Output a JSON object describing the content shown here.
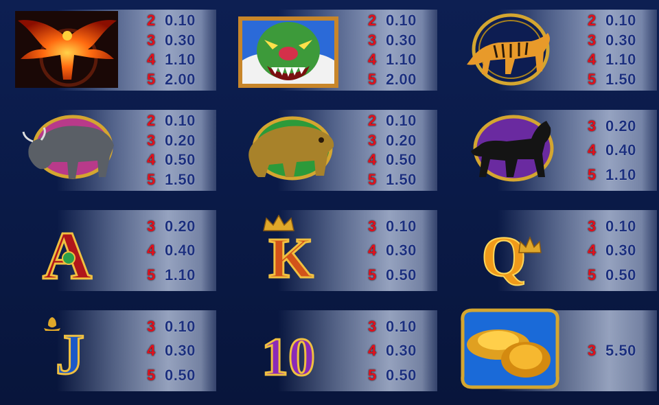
{
  "colors": {
    "count": "#e3101c",
    "value": "#1b2f7e",
    "background": "#0d1f52"
  },
  "paytable": [
    {
      "symbol": "phoenix",
      "icon": "phoenix-icon",
      "pays": [
        {
          "count": "2",
          "value": "0.10"
        },
        {
          "count": "3",
          "value": "0.30"
        },
        {
          "count": "4",
          "value": "1.10"
        },
        {
          "count": "5",
          "value": "2.00"
        }
      ]
    },
    {
      "symbol": "dragon",
      "icon": "dragon-icon",
      "pays": [
        {
          "count": "2",
          "value": "0.10"
        },
        {
          "count": "3",
          "value": "0.30"
        },
        {
          "count": "4",
          "value": "1.10"
        },
        {
          "count": "5",
          "value": "2.00"
        }
      ]
    },
    {
      "symbol": "tiger",
      "icon": "tiger-icon",
      "pays": [
        {
          "count": "2",
          "value": "0.10"
        },
        {
          "count": "3",
          "value": "0.30"
        },
        {
          "count": "4",
          "value": "1.10"
        },
        {
          "count": "5",
          "value": "1.50"
        }
      ]
    },
    {
      "symbol": "bull",
      "icon": "bull-icon",
      "pays": [
        {
          "count": "2",
          "value": "0.10"
        },
        {
          "count": "3",
          "value": "0.20"
        },
        {
          "count": "4",
          "value": "0.50"
        },
        {
          "count": "5",
          "value": "1.50"
        }
      ]
    },
    {
      "symbol": "bear",
      "icon": "bear-icon",
      "pays": [
        {
          "count": "2",
          "value": "0.10"
        },
        {
          "count": "3",
          "value": "0.20"
        },
        {
          "count": "4",
          "value": "0.50"
        },
        {
          "count": "5",
          "value": "1.50"
        }
      ]
    },
    {
      "symbol": "horse",
      "icon": "horse-icon",
      "pays": [
        {
          "count": "3",
          "value": "0.20"
        },
        {
          "count": "4",
          "value": "0.40"
        },
        {
          "count": "5",
          "value": "1.10"
        }
      ]
    },
    {
      "symbol": "A",
      "icon": "ace-icon",
      "glyph": "A",
      "pays": [
        {
          "count": "3",
          "value": "0.20"
        },
        {
          "count": "4",
          "value": "0.40"
        },
        {
          "count": "5",
          "value": "1.10"
        }
      ]
    },
    {
      "symbol": "K",
      "icon": "king-icon",
      "glyph": "K",
      "pays": [
        {
          "count": "3",
          "value": "0.10"
        },
        {
          "count": "4",
          "value": "0.30"
        },
        {
          "count": "5",
          "value": "0.50"
        }
      ]
    },
    {
      "symbol": "Q",
      "icon": "queen-icon",
      "glyph": "Q",
      "pays": [
        {
          "count": "3",
          "value": "0.10"
        },
        {
          "count": "4",
          "value": "0.30"
        },
        {
          "count": "5",
          "value": "0.50"
        }
      ]
    },
    {
      "symbol": "J",
      "icon": "jack-icon",
      "glyph": "J",
      "pays": [
        {
          "count": "3",
          "value": "0.10"
        },
        {
          "count": "4",
          "value": "0.30"
        },
        {
          "count": "5",
          "value": "0.50"
        }
      ]
    },
    {
      "symbol": "10",
      "icon": "ten-icon",
      "glyph": "10",
      "pays": [
        {
          "count": "3",
          "value": "0.10"
        },
        {
          "count": "4",
          "value": "0.30"
        },
        {
          "count": "5",
          "value": "0.50"
        }
      ]
    },
    {
      "symbol": "gold-ingots",
      "icon": "gold-ingot-icon",
      "pays": [
        {
          "count": "3",
          "value": "5.50"
        }
      ]
    }
  ]
}
